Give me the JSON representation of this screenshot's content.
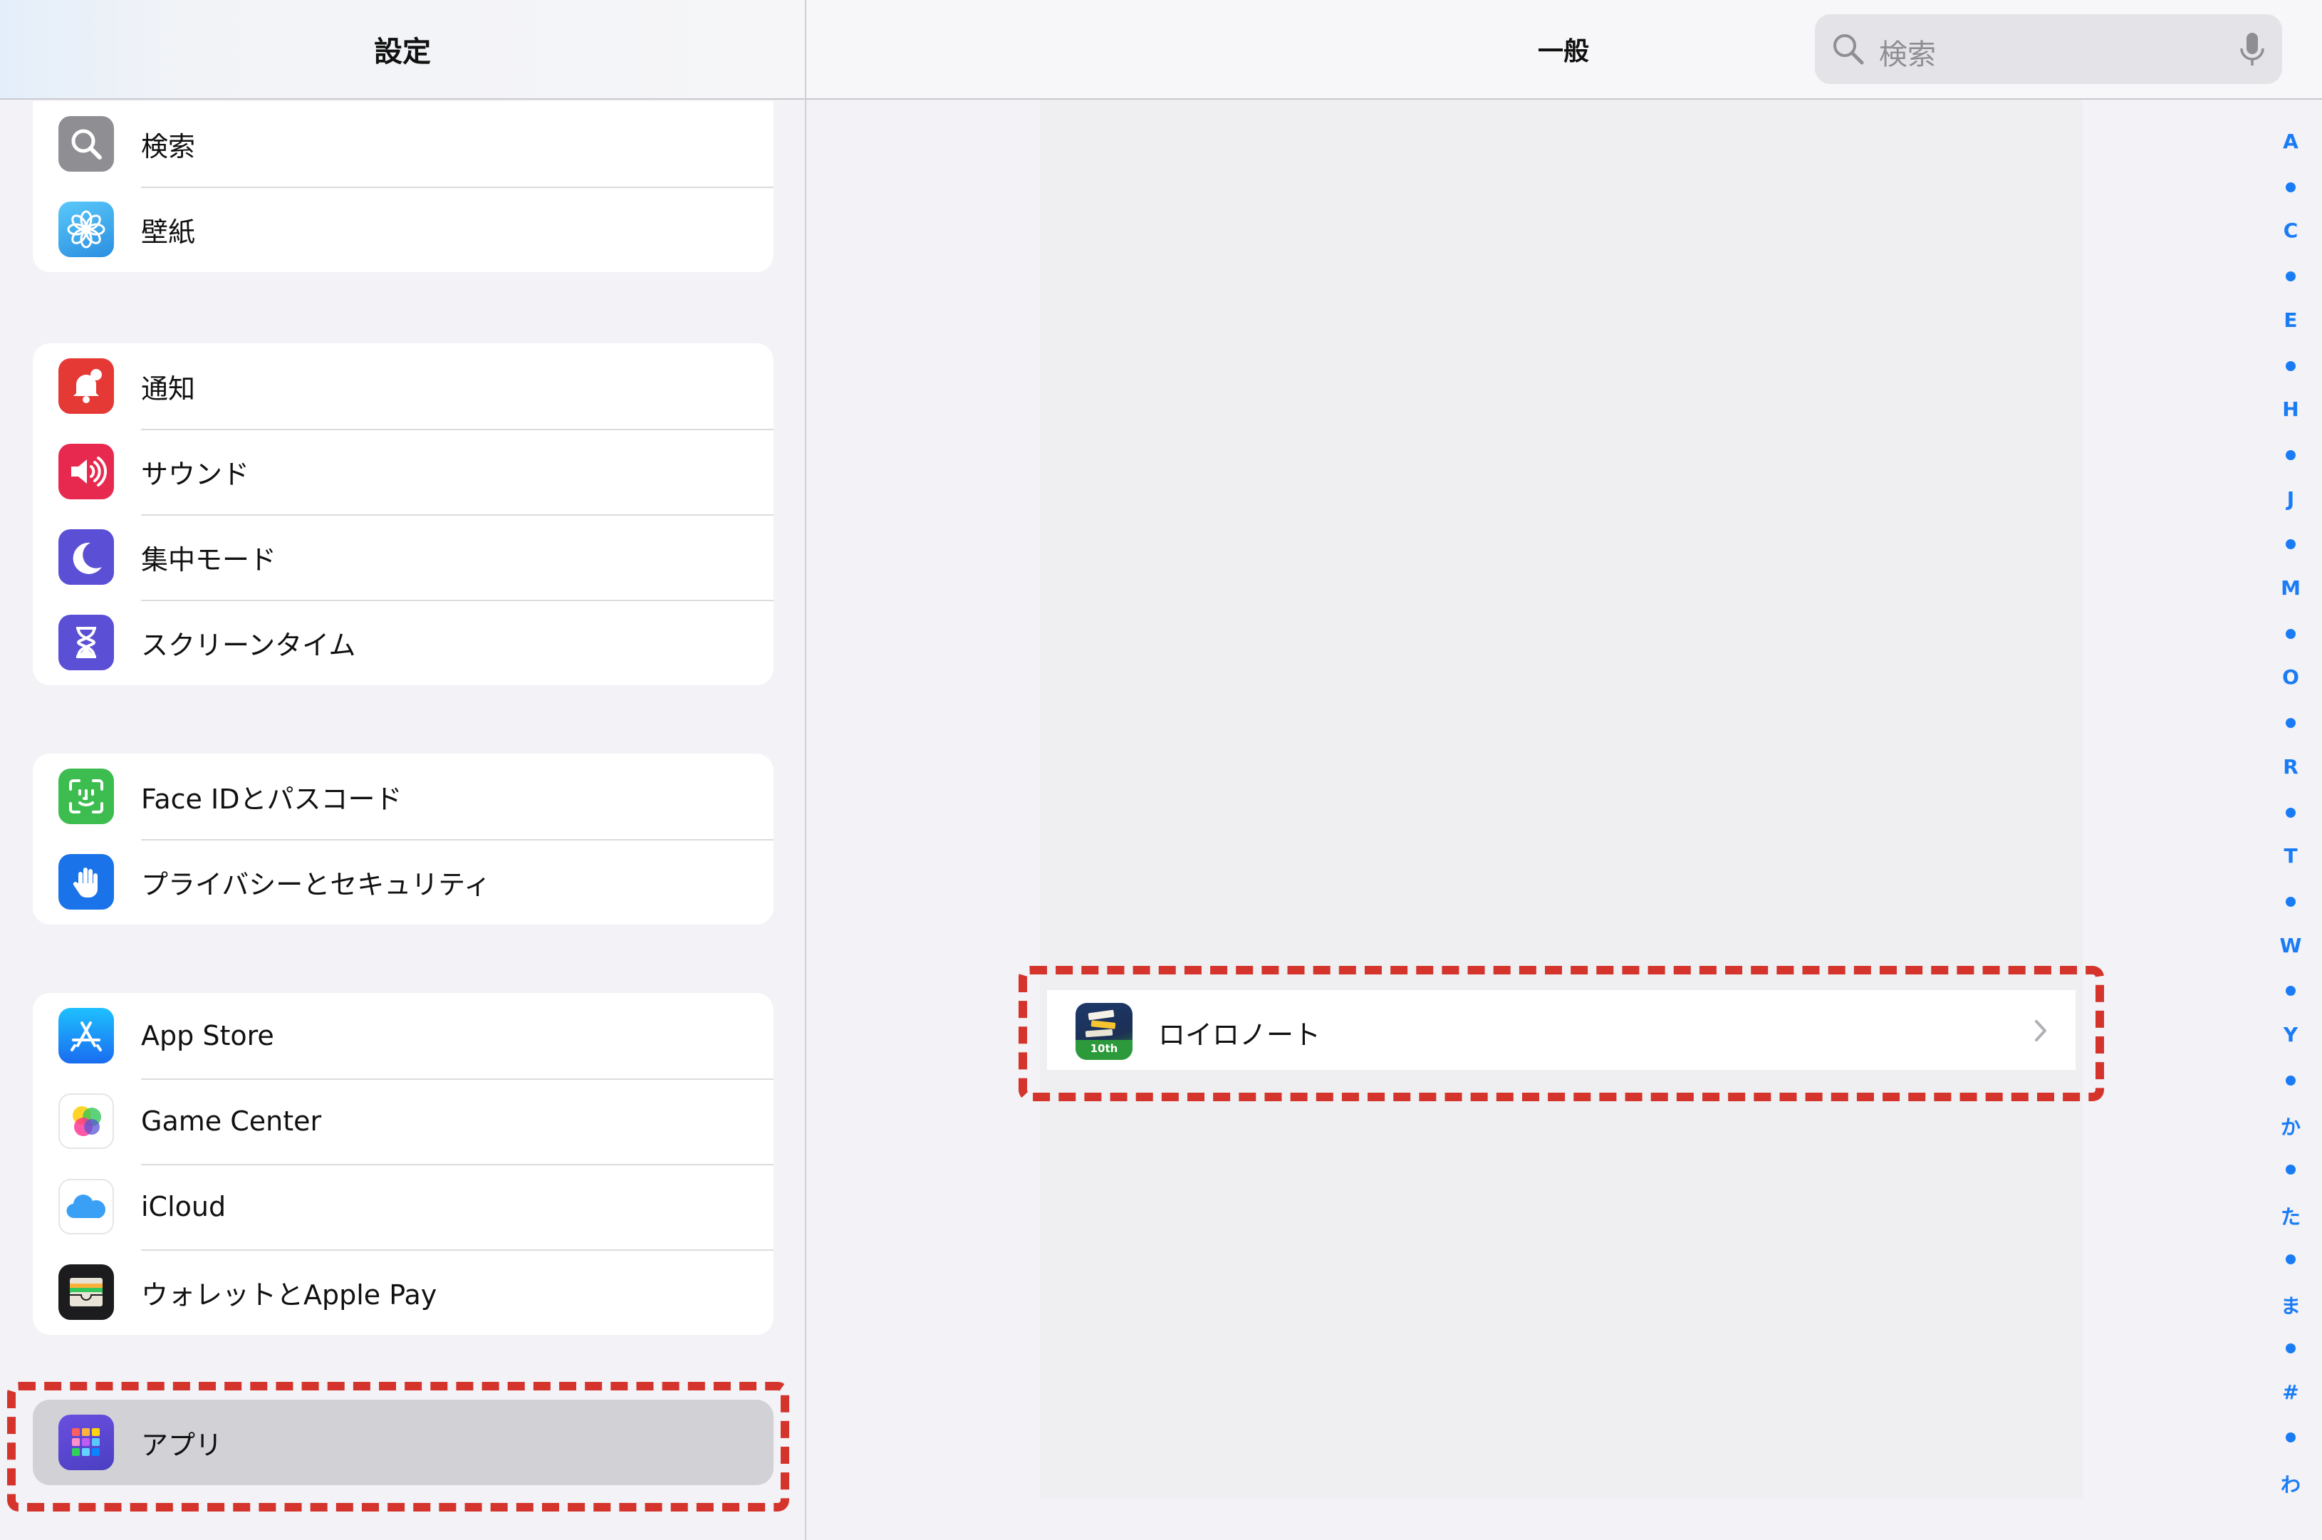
{
  "sidebar": {
    "title": "設定",
    "groups": [
      [
        {
          "label": "検索",
          "icon": "search-icon",
          "color": "#8e8e93"
        },
        {
          "label": "壁紙",
          "icon": "wallpaper-flower-icon",
          "color": "#3aa4e0"
        }
      ],
      [
        {
          "label": "通知",
          "icon": "notification-bell-icon",
          "color": "#e53935"
        },
        {
          "label": "サウンド",
          "icon": "speaker-icon",
          "color": "#e8294f"
        },
        {
          "label": "集中モード",
          "icon": "moon-icon",
          "color": "#5b4fd6"
        },
        {
          "label": "スクリーンタイム",
          "icon": "hourglass-icon",
          "color": "#5b4fd6"
        }
      ],
      [
        {
          "label": "Face IDとパスコード",
          "icon": "face-id-icon",
          "color": "#3dbd4f"
        },
        {
          "label": "プライバシーとセキュリティ",
          "icon": "hand-icon",
          "color": "#1a73e8"
        }
      ],
      [
        {
          "label": "App Store",
          "icon": "app-store-icon",
          "color": "#1a8cf0"
        },
        {
          "label": "Game Center",
          "icon": "game-center-icon",
          "color": "#ffffff"
        },
        {
          "label": "iCloud",
          "icon": "icloud-icon",
          "color": "#ffffff"
        },
        {
          "label": "ウォレットとApple Pay",
          "icon": "wallet-icon",
          "color": "#1c1c1e"
        }
      ]
    ],
    "apps_item": {
      "label": "アプリ",
      "icon": "apps-grid-icon",
      "color": "#5b4fd6"
    }
  },
  "detail": {
    "title": "一般",
    "search_placeholder": "検索",
    "app_row": {
      "label": "ロイロノート",
      "icon": "loilo-note-app-icon"
    }
  },
  "index_letters": [
    "A",
    "C",
    "E",
    "H",
    "J",
    "M",
    "O",
    "R",
    "T",
    "W",
    "Y",
    "か",
    "た",
    "ま",
    "#",
    "わ"
  ],
  "highlight_color": "#d4342b"
}
